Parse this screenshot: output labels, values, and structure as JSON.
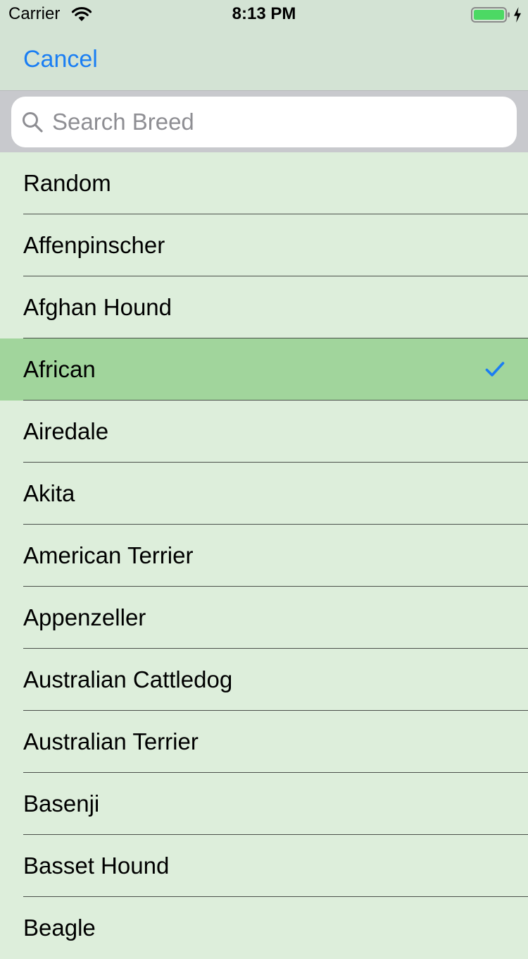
{
  "status_bar": {
    "carrier": "Carrier",
    "time": "8:13 PM",
    "icons": [
      "wifi-icon",
      "battery-icon",
      "charging-icon"
    ]
  },
  "nav": {
    "cancel_label": "Cancel"
  },
  "search": {
    "placeholder": "Search Breed",
    "value": "",
    "icon": "search-icon"
  },
  "breeds": {
    "selected": "African",
    "items": [
      {
        "label": "Random",
        "selected": false
      },
      {
        "label": "Affenpinscher",
        "selected": false
      },
      {
        "label": "Afghan Hound",
        "selected": false
      },
      {
        "label": "African",
        "selected": true
      },
      {
        "label": "Airedale",
        "selected": false
      },
      {
        "label": "Akita",
        "selected": false
      },
      {
        "label": "American Terrier",
        "selected": false
      },
      {
        "label": "Appenzeller",
        "selected": false
      },
      {
        "label": "Australian Cattledog",
        "selected": false
      },
      {
        "label": "Australian Terrier",
        "selected": false
      },
      {
        "label": "Basenji",
        "selected": false
      },
      {
        "label": "Basset Hound",
        "selected": false
      },
      {
        "label": "Beagle",
        "selected": false
      }
    ]
  },
  "colors": {
    "accent": "#1a7ef3",
    "list_background": "#ddeedb",
    "selected_row": "#a1d59c",
    "header_background": "#d3e3d4",
    "search_bar_background": "#c8c9cd",
    "battery_fill": "#4cd964"
  }
}
